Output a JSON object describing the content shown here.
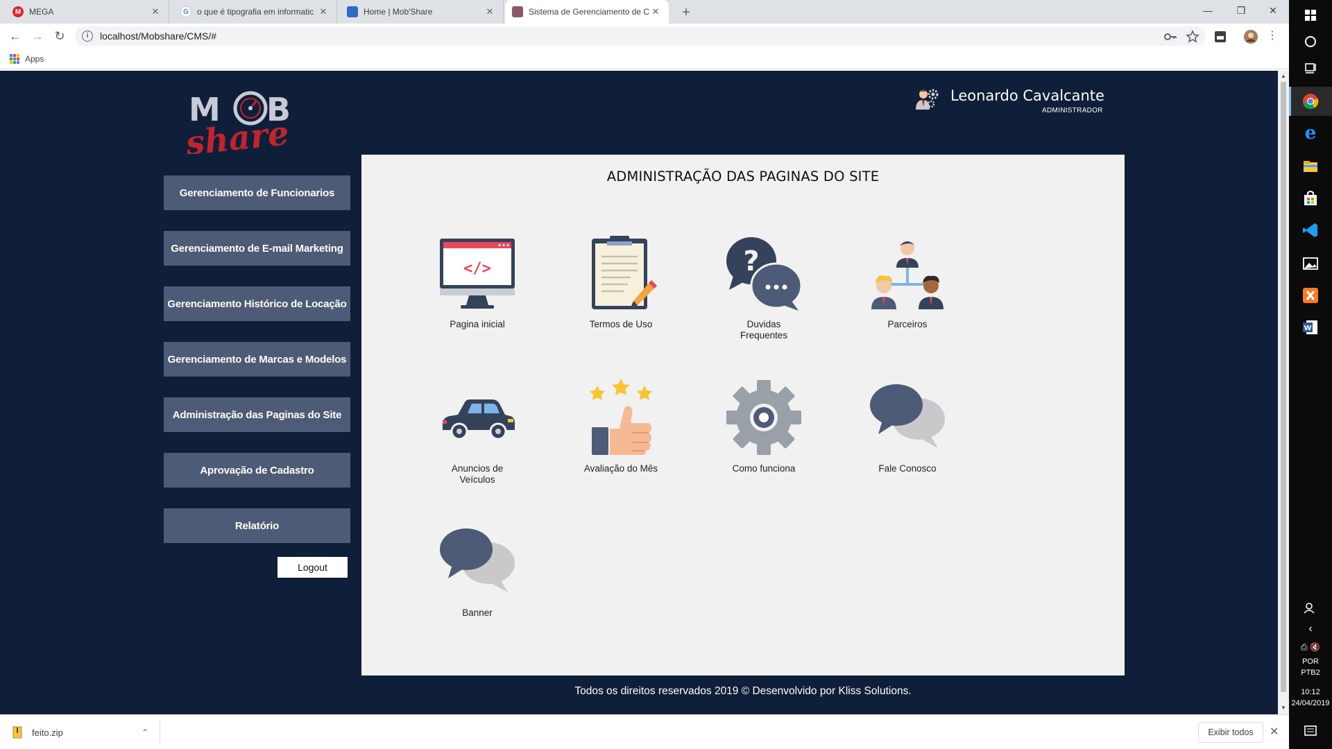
{
  "browser": {
    "tabs": [
      {
        "title": "MEGA",
        "active": false
      },
      {
        "title": "o que é tipografia em informatic",
        "active": false
      },
      {
        "title": "Home | Mob'Share",
        "active": false
      },
      {
        "title": "Sistema de Gerenciamento de Co",
        "active": true
      }
    ],
    "new_tab": "+",
    "close_glyph": "✕",
    "url": "localhost/Mobshare/CMS/#",
    "bookmarks": {
      "apps_label": "Apps"
    }
  },
  "header": {
    "admin_name": "Leonardo Cavalcante",
    "admin_role": "ADMINISTRADOR"
  },
  "sidebar": {
    "items": [
      {
        "label": "Gerenciamento de Funcionarios"
      },
      {
        "label": "Gerenciamento de E-mail Marketing"
      },
      {
        "label": "Gerenciamento Histórico de Locação"
      },
      {
        "label": "Gerenciamento de Marcas e Modelos"
      },
      {
        "label": "Administração das Paginas do Site"
      },
      {
        "label": "Aprovação de Cadastro"
      },
      {
        "label": "Relatório"
      }
    ],
    "logout_label": "Logout"
  },
  "main": {
    "title": "ADMINISTRAÇÃO DAS PAGINAS DO SITE",
    "cards": [
      {
        "label": "Pagina inicial",
        "icon": "code-monitor-icon"
      },
      {
        "label": "Termos de Uso",
        "icon": "clipboard-pencil-icon"
      },
      {
        "label": "Duvidas Frequentes",
        "icon": "question-chat-icon"
      },
      {
        "label": "Parceiros",
        "icon": "team-hierarchy-icon"
      },
      {
        "label": "Anuncios de Veículos",
        "icon": "car-icon"
      },
      {
        "label": "Avaliação do Mês",
        "icon": "thumbs-up-stars-icon"
      },
      {
        "label": "Como funciona",
        "icon": "gear-icon"
      },
      {
        "label": "Fale Conosco",
        "icon": "chat-bubbles-icon"
      },
      {
        "label": "Banner",
        "icon": "chat-bubbles-icon"
      }
    ]
  },
  "footer": {
    "text": "Todos os direitos reservados 2019 © Desenvolvido por Kliss Solutions."
  },
  "downloads": {
    "file": "feito.zip",
    "show_all": "Exibir todos"
  },
  "taskbar": {
    "lang1": "POR",
    "lang2": "PTB2",
    "time": "10:12",
    "date": "24/04/2019"
  },
  "colors": {
    "page_bg": "#0f1f3a",
    "menu_btn": "#4e5b76",
    "panel_bg": "#f1f1f1",
    "logo_red": "#c0242d"
  }
}
